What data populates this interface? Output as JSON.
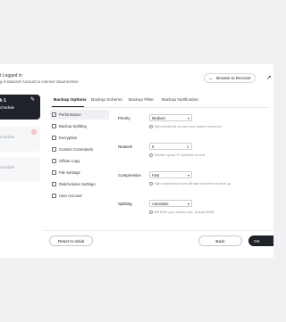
{
  "header": {
    "login_title": "t Logged in",
    "login_subtitle": "g in EaseUS Account to connect cloud service",
    "browse_label": "Browse to Recover",
    "cut_icon": "cloud-arrow-icon"
  },
  "sidebar": {
    "active_task": {
      "title": "k 1",
      "subtitle": "chedule"
    },
    "ghost_1": "chedule",
    "ghost_2": "chedule"
  },
  "tabs": [
    "Backup Options",
    "Backup Scheme",
    "Backup Filter",
    "Backup Notification"
  ],
  "menu": [
    "Performance",
    "Backup Splitting",
    "Encryption",
    "Custom Commands",
    "Offsite Copy",
    "File Settings",
    "Disk/Volume Settings",
    "User Account"
  ],
  "settings": {
    "priority": {
      "label": "Priority",
      "value": "Medium",
      "hint": "High priority will occupy more system resources"
    },
    "network": {
      "label": "Network",
      "value": "0",
      "hint": "Transfer speed \"0\" indicates no limit"
    },
    "compression": {
      "label": "Compression",
      "value": "Fast",
      "hint": "High compression level will take more time to back up"
    },
    "splitting": {
      "label": "Splitting",
      "value": "Automatic",
      "hint": "Will Enter your desired size, at least 50MB"
    }
  },
  "buttons": {
    "reset": "Reset to Initial",
    "back": "Back",
    "ok": "OK"
  }
}
